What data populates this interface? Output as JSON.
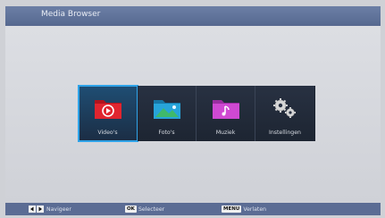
{
  "header": {
    "title": "Media Browser"
  },
  "tiles": [
    {
      "label": "Video's",
      "icon": "video-folder-icon",
      "color": "#d8232e",
      "selected": true
    },
    {
      "label": "Foto's",
      "icon": "photo-folder-icon",
      "color": "#1f9ad0"
    },
    {
      "label": "Muziek",
      "icon": "music-folder-icon",
      "color": "#c53fc8"
    },
    {
      "label": "Instellingen",
      "icon": "gears-icon",
      "color": "#c8c8c8"
    }
  ],
  "footer": {
    "navigate": {
      "key": "◀ ▶",
      "label": "Navigeer"
    },
    "select": {
      "key": "OK",
      "label": "Selecteer"
    },
    "exit": {
      "key": "MENU",
      "label": "Verlaten"
    }
  }
}
